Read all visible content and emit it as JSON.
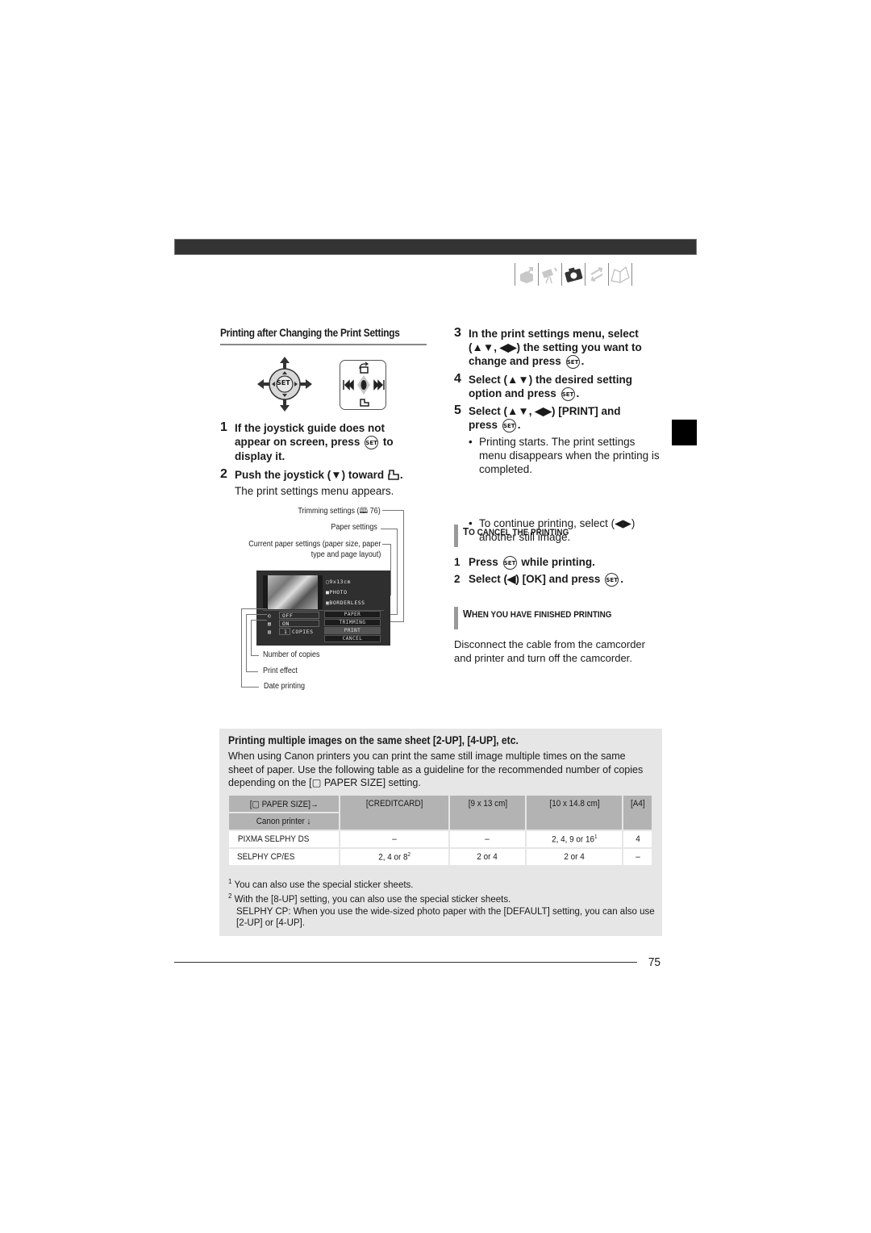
{
  "header": {
    "nav_icons": [
      "camcorder-menu-icon",
      "movie-camera-icon",
      "still-camera-icon",
      "transfer-arrows-icon",
      "book-icon"
    ],
    "active_nav_icon": "still-camera-icon"
  },
  "left": {
    "section_title": "Printing after Changing the Print Settings",
    "steps": [
      {
        "num": "1",
        "text_a": "If the joystick guide does not appear on screen, press",
        "set": "SET",
        "text_b": "to display it."
      },
      {
        "num": "2",
        "text_a": "Push the joystick (▼) toward",
        "text_b": ".",
        "sub": "The print settings menu appears."
      }
    ],
    "joystick": {
      "set_label": "SET"
    },
    "callouts": {
      "trimming": "Trimming settings (",
      "trimming_page": " 76)",
      "paper": "Paper settings",
      "current_paper_1": "Current paper settings (paper size, paper",
      "current_paper_2": "type and page layout)",
      "copies": "Number of copies",
      "effect": "Print effect",
      "date": "Date printing"
    },
    "screen": {
      "paper_size": "9x13cm",
      "paper_type": "PHOTO",
      "layout": "BORDERLESS",
      "date_value": "OFF",
      "effect_value": "ON",
      "copies_value": "1",
      "copies_label": "COPIES",
      "buttons": [
        "PAPER",
        "TRIMMING",
        "PRINT",
        "CANCEL"
      ]
    }
  },
  "right": {
    "steps": [
      {
        "num": "3",
        "text": "In the print settings menu, select (▲▼, ◀▶) the setting you want to change and press",
        "end": "."
      },
      {
        "num": "4",
        "text": "Select (▲▼) the desired setting option and press",
        "end": "."
      },
      {
        "num": "5",
        "text": "Select (▲▼, ◀▶) [PRINT] and press",
        "end": "."
      }
    ],
    "bullets": [
      "Printing starts. The print settings menu disappears when the printing is completed.",
      "To continue printing, select (◀▶) another still image."
    ],
    "cancel": {
      "title_big": "T",
      "title_rest": "O CANCEL THE PRINTING",
      "steps": [
        {
          "num": "1",
          "a": "Press",
          "b": "while printing."
        },
        {
          "num": "2",
          "a": "Select (◀) [OK] and press",
          "b": "."
        }
      ]
    },
    "finished": {
      "title_big": "W",
      "title_rest": "HEN YOU HAVE FINISHED PRINTING",
      "text": "Disconnect the cable from the camcorder and printer and turn off the camcorder."
    },
    "set_label": "SET"
  },
  "multi": {
    "title": "Printing multiple images on the same sheet [2-UP], [4-UP], etc.",
    "body_a": "When using Canon printers you can print the same still image multiple times on the same sheet of paper. Use the following table as a guideline for the recommended number of copies depending on the [",
    "body_b": " PAPER SIZE] setting.",
    "table": {
      "corner_top": "PAPER SIZE]→",
      "corner_top_open": "[",
      "corner_bottom": "Canon printer ↓",
      "columns": [
        "[CREDITCARD]",
        "[9 x 13 cm]",
        "[10 x 14.8 cm]",
        "[A4]"
      ],
      "rows": [
        {
          "printer": "PIXMA SELPHY DS",
          "values": [
            "–",
            "–",
            "2, 4, 9 or 16",
            "4"
          ],
          "sup": [
            "",
            "",
            "1",
            ""
          ]
        },
        {
          "printer": "SELPHY CP/ES",
          "values": [
            "2, 4 or 8",
            "2 or 4",
            "2 or 4",
            "–"
          ],
          "sup": [
            "2",
            "",
            "",
            ""
          ]
        }
      ]
    },
    "footnotes": [
      {
        "mark": "1",
        "text": "You can also use the special sticker sheets."
      },
      {
        "mark": "2",
        "text": "With the [8-UP] setting, you can also use the special sticker sheets."
      }
    ],
    "footnote_extra": "SELPHY CP: When you use the wide-sized photo paper with the [DEFAULT] setting, you can also use [2-UP] or [4-UP]."
  },
  "page_number": "75"
}
